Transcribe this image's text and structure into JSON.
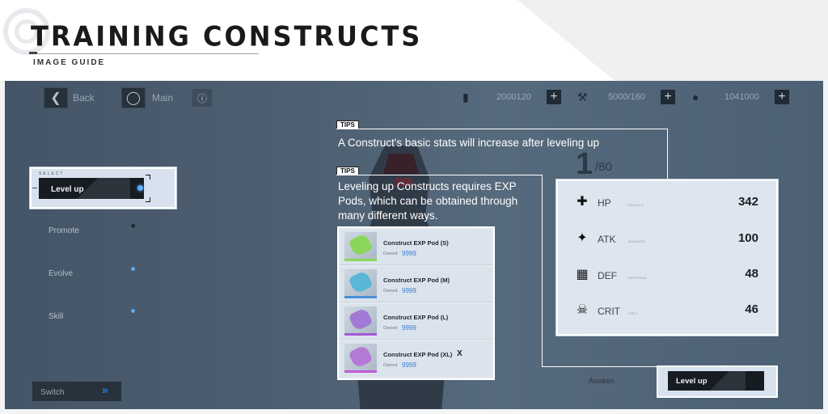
{
  "header": {
    "title": "TRAINING CONSTRUCTS",
    "subtitle": "IMAGE GUIDE"
  },
  "game": {
    "topbar": {
      "back_label": "Back",
      "main_label": "Main",
      "resources": [
        {
          "icon": "ticket-icon",
          "value": "2000120"
        },
        {
          "icon": "wrench-icon",
          "value": "5000/160"
        },
        {
          "icon": "coin-icon",
          "value": "1041000"
        }
      ]
    },
    "sidebar": {
      "select_caption": "SELECT",
      "items": [
        {
          "label": "Level up",
          "selected": true
        },
        {
          "label": "Promote",
          "locked": true
        },
        {
          "label": "Evolve"
        },
        {
          "label": "Skill"
        }
      ],
      "switch_label": "Switch"
    },
    "level": {
      "current": "1",
      "max": "/80"
    },
    "awaken_label": "Awaken"
  },
  "tips": [
    {
      "tag": "TIPS",
      "text": "A Construct's basic stats will increase after leveling up"
    },
    {
      "tag": "TIPS",
      "text_lines": [
        "Leveling up Constructs requires EXP",
        "Pods, which can be obtained through",
        "many different ways."
      ]
    }
  ],
  "exp_items": [
    {
      "name": "Construct EXP Pod (S)",
      "owned_label": "Owned",
      "owned": "9999",
      "color": "#8bd65a"
    },
    {
      "name": "Construct EXP Pod (M)",
      "owned_label": "Owned",
      "owned": "9999",
      "color": "#5ab8d6"
    },
    {
      "name": "Construct EXP Pod (L)",
      "owned_label": "Owned",
      "owned": "9999",
      "color": "#a27ad6"
    },
    {
      "name": "Construct EXP Pod (XL)",
      "owned_label": "Owned",
      "owned": "9999",
      "color": "#b47ad6",
      "close_mark": "X"
    }
  ],
  "stats": [
    {
      "icon": "cross-icon",
      "name": "HP",
      "sub": "/HEALTH",
      "value": "342"
    },
    {
      "icon": "feather-icon",
      "name": "ATK",
      "sub": "/DAMAGE",
      "value": "100"
    },
    {
      "icon": "armor-icon",
      "name": "DEF",
      "sub": "/DEFENSE",
      "value": "48"
    },
    {
      "icon": "skull-icon",
      "name": "CRIT",
      "sub": "/CRIT",
      "value": "46"
    }
  ],
  "level_up_button": "Level up",
  "colors": {
    "accent": "#5fb0ff",
    "owned_value": "#3b7fd4",
    "dark_button": "#161c22"
  }
}
